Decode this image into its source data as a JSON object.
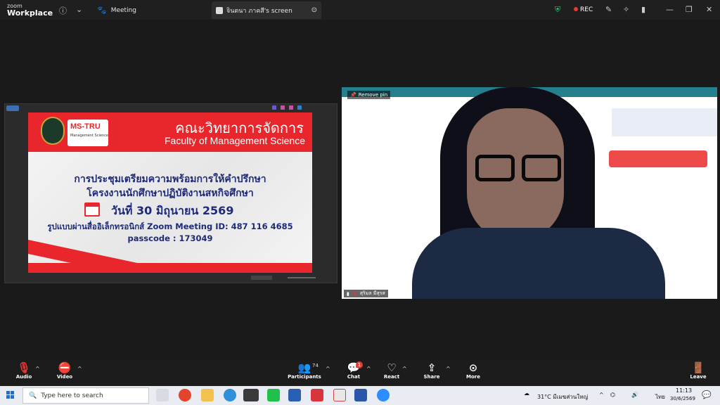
{
  "topbar": {
    "brand_line1": "zoom",
    "brand_line2": "Workplace",
    "meeting_tab": "Meeting",
    "screen_tab": "จินตนา ภาคสี's screen",
    "rec_label": "REC"
  },
  "shared_screen": {
    "slide": {
      "logo_ms": "MS-TRU",
      "logo_sub": "Management Science",
      "title_th": "คณะวิทยาการจัดการ",
      "title_en": "Faculty of Management Science",
      "line1": "การประชุมเตรียมความพร้อมการให้คำปรึกษา",
      "line2": "โครงงานนักศึกษาปฏิบัติงานสหกิจศึกษา",
      "date": "วันที่ 30 มิถุนายน 2569",
      "meeting_id": "รูปแบบผ่านสื่ออิเล็กทรอนิกส์ Zoom Meeting ID: 487 116 4685",
      "passcode": "passcode : 173049"
    }
  },
  "camera": {
    "remove_pin": "Remove pin",
    "participant_name": "สุริมล มีสุรส"
  },
  "controls": {
    "audio": "Audio",
    "video": "Video",
    "participants": "Participants",
    "participants_count": "74",
    "chat": "Chat",
    "chat_badge": "1",
    "react": "React",
    "share": "Share",
    "more": "More",
    "leave": "Leave"
  },
  "taskbar": {
    "search_placeholder": "Type here to search",
    "weather": "31°C  มีเมฆส่วนใหญ่",
    "lang": "ไทย",
    "time": "11:13",
    "date": "30/6/2569"
  },
  "colors": {
    "slide_red": "#e8262b",
    "slide_navy": "#1e2a78",
    "zoom_bg": "#1a1a1a"
  }
}
